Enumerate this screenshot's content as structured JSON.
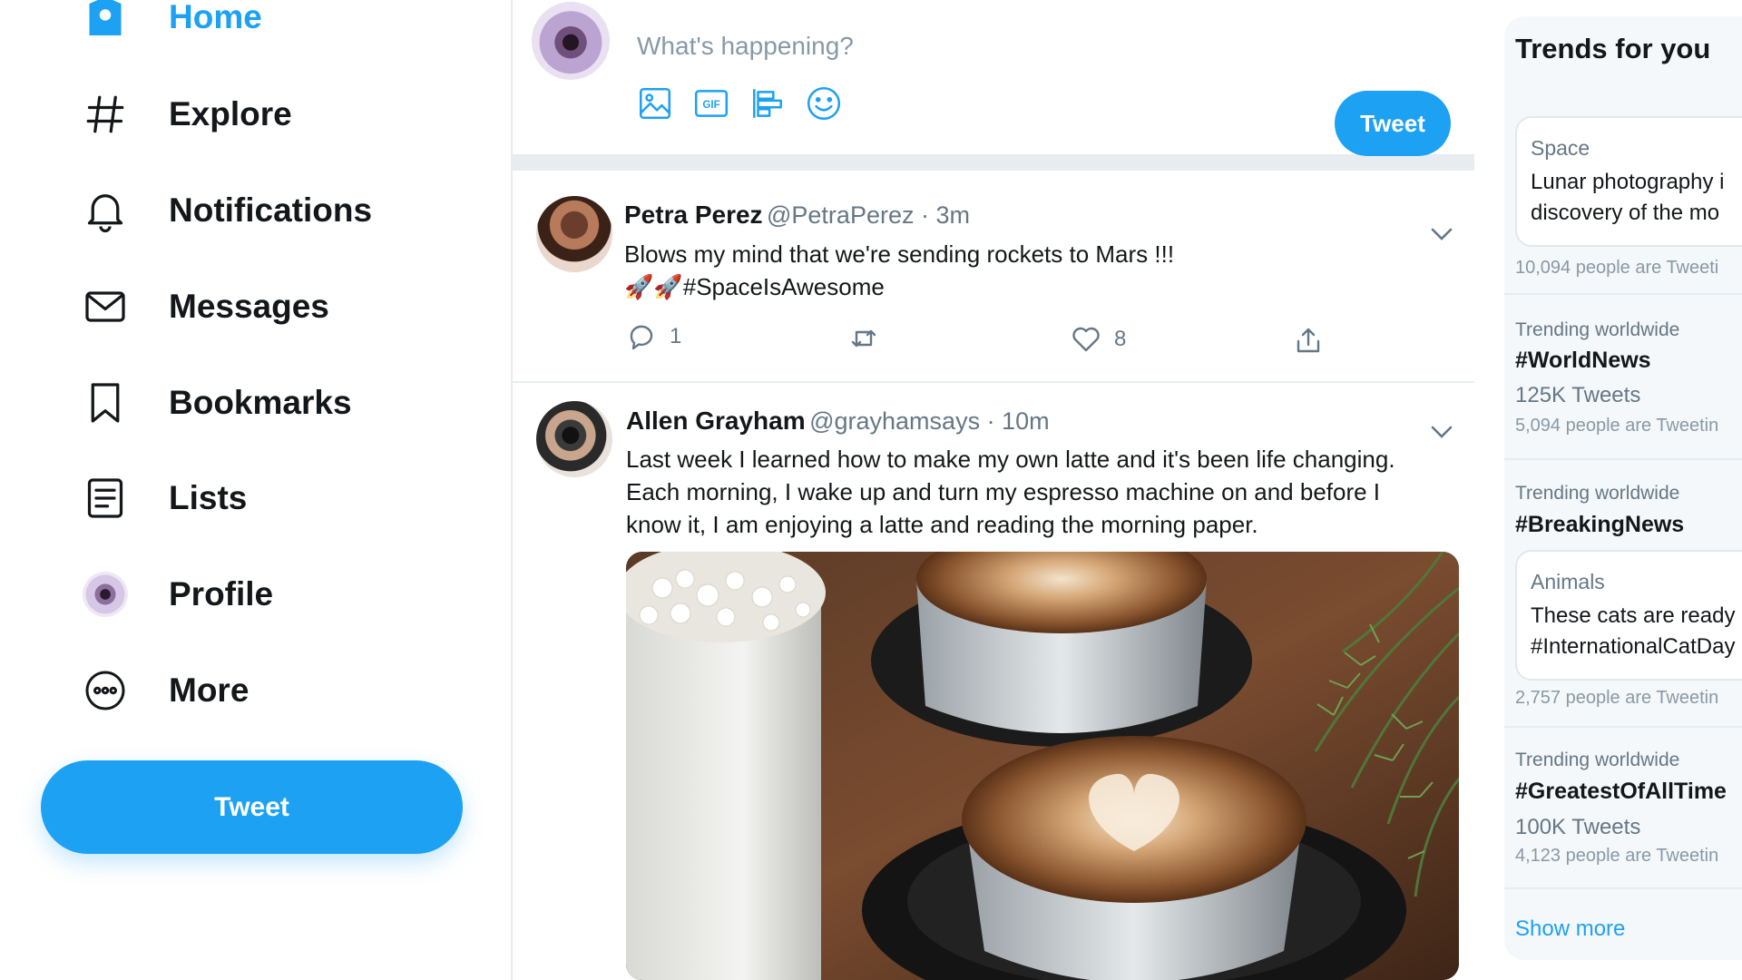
{
  "colors": {
    "accent": "#1da1f2",
    "text": "#14171a",
    "muted": "#657786",
    "border": "#e6ecf0"
  },
  "nav": {
    "items": [
      {
        "label": "Home",
        "icon": "home-icon"
      },
      {
        "label": "Explore",
        "icon": "hashtag-icon"
      },
      {
        "label": "Notifications",
        "icon": "bell-icon"
      },
      {
        "label": "Messages",
        "icon": "envelope-icon"
      },
      {
        "label": "Bookmarks",
        "icon": "bookmark-icon"
      },
      {
        "label": "Lists",
        "icon": "list-icon"
      },
      {
        "label": "Profile",
        "icon": "avatar"
      },
      {
        "label": "More",
        "icon": "more-icon"
      }
    ],
    "tweet_button": "Tweet"
  },
  "composer": {
    "placeholder": "What's happening?",
    "tools": [
      "image-icon",
      "gif-icon",
      "poll-icon",
      "emoji-icon"
    ],
    "tweet_button": "Tweet"
  },
  "tweets": [
    {
      "name": "Petra Perez",
      "meta": "@PetraPerez · 3m",
      "text_line1": "Blows my mind that we're sending rockets to Mars !!!",
      "text_line2": "🚀🚀#SpaceIsAwesome",
      "replies": "1",
      "likes": "8"
    },
    {
      "name": "Allen Grayham",
      "meta": "@grayhamsays · 10m",
      "text_line1": "Last week I learned how to make my own latte and it's been life changing.",
      "text_line2": "Each morning, I wake up and turn my espresso machine on and before I",
      "text_line3": "know it, I am enjoying a latte and reading the morning paper."
    }
  ],
  "trends": {
    "title": "Trends for you",
    "card1": {
      "category": "Space",
      "line1": "Lunar photography i",
      "line2": "discovery of the mo",
      "footer": "10,094 people are Tweeti"
    },
    "items": [
      {
        "category": "Trending worldwide",
        "tag": "#WorldNews",
        "count": "125K Tweets",
        "footer": "5,094 people are Tweetin"
      },
      {
        "category": "Trending worldwide",
        "tag": "#BreakingNews"
      },
      {
        "category": "Trending worldwide",
        "tag": "#GreatestOfAllTime",
        "count": "100K Tweets",
        "footer": "4,123 people are Tweetin"
      }
    ],
    "card2": {
      "category": "Animals",
      "line1": "These cats are ready",
      "line2": "#InternationalCatDay",
      "footer": "2,757 people are Tweetin"
    },
    "show_more": "Show more"
  }
}
